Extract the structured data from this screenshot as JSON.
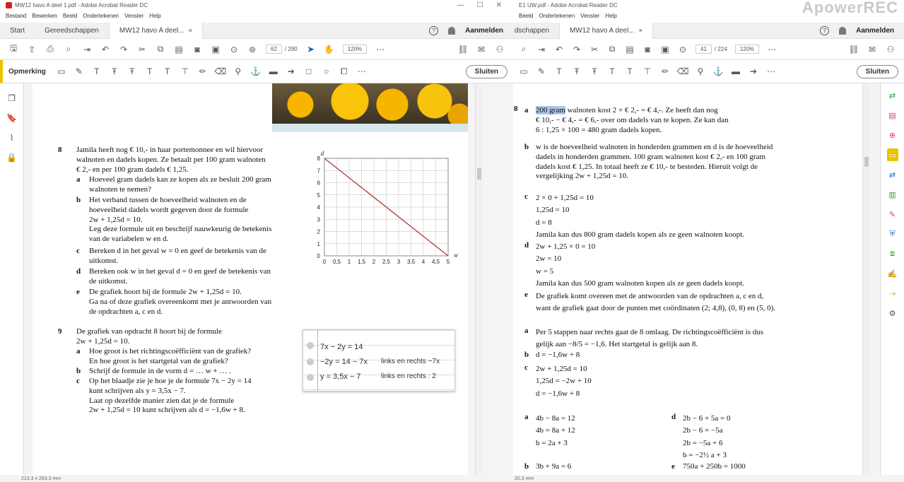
{
  "left_window": {
    "title": "MW12 havo A deel 1.pdf - Adobe Acrobat Reader DC",
    "menu": [
      "Bestand",
      "Bewerken",
      "Beeld",
      "Ondertekenen",
      "Venster",
      "Help"
    ],
    "tabs": {
      "start": "Start",
      "tools": "Gereedschappen",
      "doc": "MW12 havo A deel...",
      "close": "×"
    },
    "signin": "Aanmelden",
    "page_current": "62",
    "page_total": "/ 290",
    "zoom": "120%",
    "comment_label": "Opmerking",
    "close_button": "Sluiten",
    "status": "213,3 x 263,3 mm"
  },
  "right_window": {
    "title": "E1 UW.pdf - Adobe Acrobat Reader DC",
    "menu": [
      "Beeld",
      "Ondertekenen",
      "Venster",
      "Help"
    ],
    "tabs": {
      "tools": "dschappen",
      "doc": "MW12 havo A deel...",
      "close": "×"
    },
    "signin": "Aanmelden",
    "page_current": "41",
    "page_total": "/ 224",
    "zoom": "120%",
    "close_button": "Sluiten",
    "status": "20,3 mm"
  },
  "exercise8": {
    "number": "8",
    "lines": [
      "Jamila heeft nog € 10,- in haar portemonnee en wil hiervoor",
      "walnoten en dadels kopen. Ze betaalt per 100 gram walnoten",
      "€ 2,- en per 100 gram dadels € 1,25."
    ],
    "a_label": "a",
    "a": [
      "Hoeveel gram dadels kan ze kopen als ze besluit 200 gram",
      "walnoten te nemen?"
    ],
    "b_label": "b",
    "b": [
      "Het verband tussen de hoeveelheid walnoten en de",
      "hoeveelheid dadels wordt gegeven door de formule",
      "2w + 1,25d = 10.",
      "Leg deze formule uit en beschrijf nauwkeurig de betekenis",
      "van de variabelen w en d."
    ],
    "c_label": "c",
    "c": [
      "Bereken d in het geval w = 0 en geef de betekenis van de",
      "uitkomst."
    ],
    "d_label": "d",
    "d": [
      "Bereken ook w in het geval d = 0 en geef de betekenis van",
      "de uitkomst."
    ],
    "e_label": "e",
    "e": [
      "De grafiek hoort bij de formule 2w + 1,25d = 10.",
      "Ga na of deze grafiek overeenkomt met je antwoorden van",
      "de opdrachten a, c en d."
    ]
  },
  "exercise9": {
    "number": "9",
    "lines": [
      "De grafiek van opdracht 8 hoort bij de formule",
      "2w + 1,25d = 10."
    ],
    "a_label": "a",
    "a": [
      "Hoe groot is het richtingscoëfficiënt van de grafiek?",
      "En hoe groot is het startgetal van de grafiek?"
    ],
    "b_label": "b",
    "b": [
      "Schrijf de formule in de vorm d = … w + … ."
    ],
    "c_label": "c",
    "c": [
      "Op het blaadje zie je hoe je de formule 7x − 2y = 14",
      "kunt schrijven als y = 3,5x − 7.",
      "Laat op dezelfde manier zien dat je de formule",
      "2w + 1,25d = 10 kunt schrijven als d = −1,6w + 8."
    ]
  },
  "notecard": {
    "rows": [
      "7x − 2y = 14",
      "−2y = 14 − 7x",
      "links en rechts −7x",
      "y = 3,5x − 7",
      "links en rechts : 2"
    ]
  },
  "chart_data": {
    "type": "line",
    "xlabel": "w",
    "ylabel": "d",
    "x_ticks": [
      "0",
      "0,5",
      "1",
      "1,5",
      "2",
      "2,5",
      "3",
      "3,5",
      "4",
      "4,5",
      "5"
    ],
    "y_ticks": [
      "0",
      "1",
      "2",
      "3",
      "4",
      "5",
      "6",
      "7",
      "8"
    ],
    "xlim": [
      0,
      5
    ],
    "ylim": [
      0,
      8
    ],
    "grid": true,
    "series": [
      {
        "x": [
          0,
          5
        ],
        "y": [
          8,
          0
        ],
        "color": "#b03a3a"
      }
    ]
  },
  "answers": {
    "a8_num": "8",
    "a8_a_label": "a",
    "a8_a_hl": "200 gram",
    "a8_a": [
      "walnoten kost 2 × € 2,- = € 4,-. Ze heeft dan nog",
      "€ 10,- − € 4,- = € 6,- over om dadels van te kopen. Ze kan dan",
      "6 : 1,25 × 100 = 480 gram dadels kopen."
    ],
    "a8_b_label": "b",
    "a8_b": [
      "w is de hoeveelheid walnoten in honderden grammen en d is de hoeveelheid",
      "dadels in honderden grammen. 100 gram walnoten kost € 2,- en 100 gram",
      "dadels kost € 1,25. In totaal heeft ze € 10,- te besteden. Hieruit volgt de",
      "vergelijking 2w + 1,25d = 10."
    ],
    "a8_c_label": "c",
    "a8_c": [
      "2 × 0 + 1,25d = 10",
      "1,25d = 10",
      "d = 8",
      "Jamila kan dus 800 gram dadels kopen als ze geen walnoten koopt."
    ],
    "a8_d_label": "d",
    "a8_d": [
      "2w + 1,25 × 0 = 10",
      "2w = 10",
      "w = 5",
      "Jamila kan dus 500 gram walnoten kopen als ze geen dadels koopt."
    ],
    "a8_e_label": "e",
    "a8_e": [
      "De grafiek komt overeen met de antwoorden van de opdrachten a, c en d,",
      "want de grafiek gaat door de punten met coördinaten (2; 4,8), (0, 8) en (5, 0)."
    ],
    "a9_a_label": "a",
    "a9_a": [
      "Per 5 stappen naar rechts gaat de 8 omlaag. De richtingscoëfficiënt is dus",
      "gelijk aan −8/5 = −1,6. Het startgetal is gelijk aan 8."
    ],
    "a9_b_label": "b",
    "a9_b": [
      "d = −1,6w + 8"
    ],
    "a9_c_label": "c",
    "a9_c": [
      "2w + 1,25d = 10",
      "1,25d = −2w + 10",
      "d = −1,6w + 8"
    ],
    "a10_a_label": "a",
    "a10_a": [
      "4b − 8a = 12",
      "4b = 8a + 12",
      "b = 2a + 3"
    ],
    "a10_d_label": "d",
    "a10_d": [
      "2b − 6 + 5a = 0",
      "2b − 6 = −5a",
      "2b = −5a + 6",
      "b = −2½ a + 3"
    ],
    "a10_b_label": "b",
    "a10_b": [
      "3b + 9a = 6"
    ],
    "a10_e_label": "e",
    "a10_e": [
      "750a + 250b = 1000"
    ]
  },
  "watermark": "ApowerREC",
  "colors": {
    "accent_yellow": "#e9c400",
    "pink": "#d2446b",
    "green": "#3a9a3a",
    "blue": "#2a6fd1"
  }
}
